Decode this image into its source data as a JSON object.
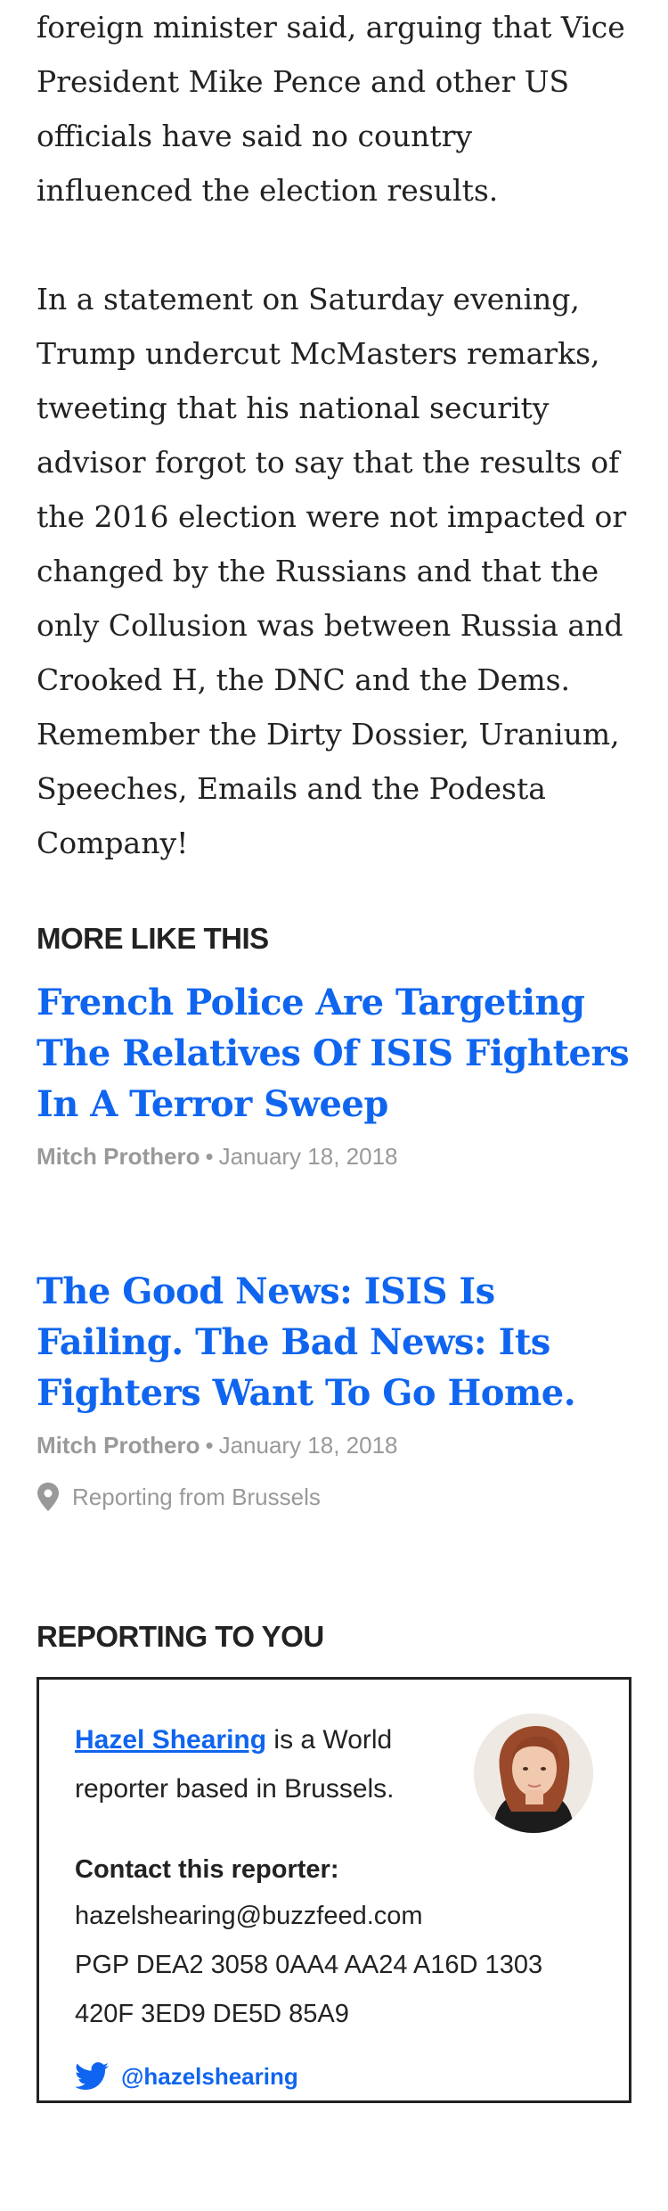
{
  "article": {
    "paragraphs": [
      "foreign minister said, arguing that Vice President Mike Pence and other US officials have said no country influenced the election results.",
      "In a statement on Saturday evening, Trump undercut McMasters remarks, tweeting that his national security advisor forgot to say that the results of the 2016 election were not impacted or changed by the Russians and that the only Collusion was between Russia and Crooked H, the DNC and the Dems. Remember the Dirty Dossier, Uranium, Speeches, Emails and the Podesta Company!"
    ]
  },
  "more_like_this": {
    "heading": "MORE LIKE THIS",
    "stories": [
      {
        "title": "French Police Are Targeting The Relatives Of ISIS Fighters In A Terror Sweep",
        "author": "Mitch Prothero",
        "separator": "•",
        "date": "January 18, 2018"
      },
      {
        "title": "The Good News: ISIS Is Failing. The Bad News: Its Fighters Want To Go Home.",
        "author": "Mitch Prothero",
        "separator": "•",
        "date": "January 18, 2018",
        "location": "Reporting from Brussels"
      }
    ]
  },
  "reporting_to_you": {
    "heading": "REPORTING TO YOU",
    "reporter_name": "Hazel Shearing",
    "reporter_description": " is a World reporter based in Brussels.",
    "contact_label": "Contact this reporter:",
    "email": "hazelshearing@buzzfeed.com",
    "pgp_line_1": "PGP DEA2 3058 0AA4 AA24 A16D 1303",
    "pgp_line_2": "420F 3ED9 DE5D 85A9",
    "twitter_handle": "@hazelshearing"
  },
  "colors": {
    "link_blue": "#0f65ef",
    "text": "#222222",
    "meta_gray": "#999999"
  },
  "icons": {
    "location": "map-pin-icon",
    "twitter": "twitter-bird-icon"
  }
}
